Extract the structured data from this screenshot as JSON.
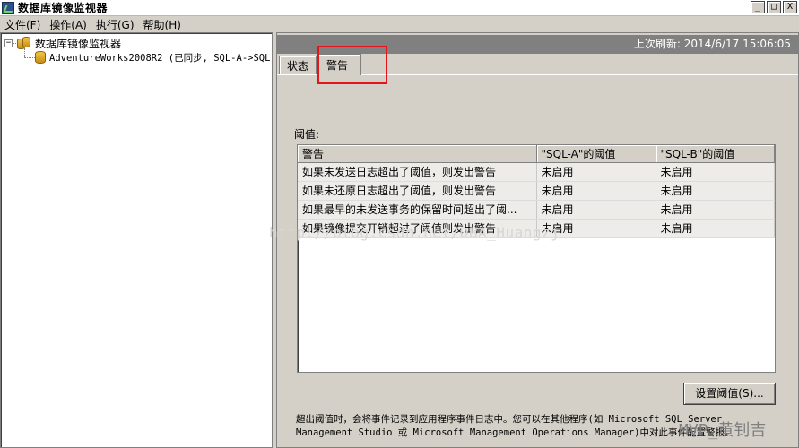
{
  "window": {
    "title": "数据库镜像监视器",
    "icon": "monitor-icon",
    "minimize_label": "_",
    "maximize_label": "□",
    "close_label": "X"
  },
  "menu": {
    "items": [
      "文件(F)",
      "操作(A)",
      "执行(G)",
      "帮助(H)"
    ]
  },
  "tree": {
    "toggle": "−",
    "root_label": "数据库镜像监视器",
    "child_label": "AdventureWorks2008R2 (已同步, SQL-A->SQL-"
  },
  "header": {
    "last_refresh": "上次刷新: 2014/6/17 15:06:05"
  },
  "tabs": [
    {
      "label": "状态",
      "active": false
    },
    {
      "label": "警告",
      "active": true
    }
  ],
  "thresholds": {
    "label": "阈值:",
    "columns": [
      "警告",
      "\"SQL-A\"的阈值",
      "\"SQL-B\"的阈值"
    ],
    "rows": [
      [
        "如果未发送日志超出了阈值，则发出警告",
        "未启用",
        "未启用"
      ],
      [
        "如果未还原日志超出了阈值，则发出警告",
        "未启用",
        "未启用"
      ],
      [
        "如果最早的未发送事务的保留时间超出了阈...",
        "未启用",
        "未启用"
      ],
      [
        "如果镜像提交开销超过了阈值则发出警告",
        "未启用",
        "未启用"
      ]
    ]
  },
  "buttons": {
    "set_thresholds": "设置阈值(S)..."
  },
  "info": {
    "text": "超出阈值时，会将事件记录到应用程序事件日志中。您可以在其他程序(如 Microsoft SQL Server Management Studio 或 Microsoft Management Operations Manager)中对此事件配置警报。"
  },
  "watermarks": {
    "center": "http://blog.csdn.net/DBA_Huangzj",
    "corner": "MVP_黄钊吉"
  },
  "colors": {
    "highlight_border": "#e0161b",
    "header_bg": "#808080",
    "window_bg": "#d4d0c8"
  }
}
